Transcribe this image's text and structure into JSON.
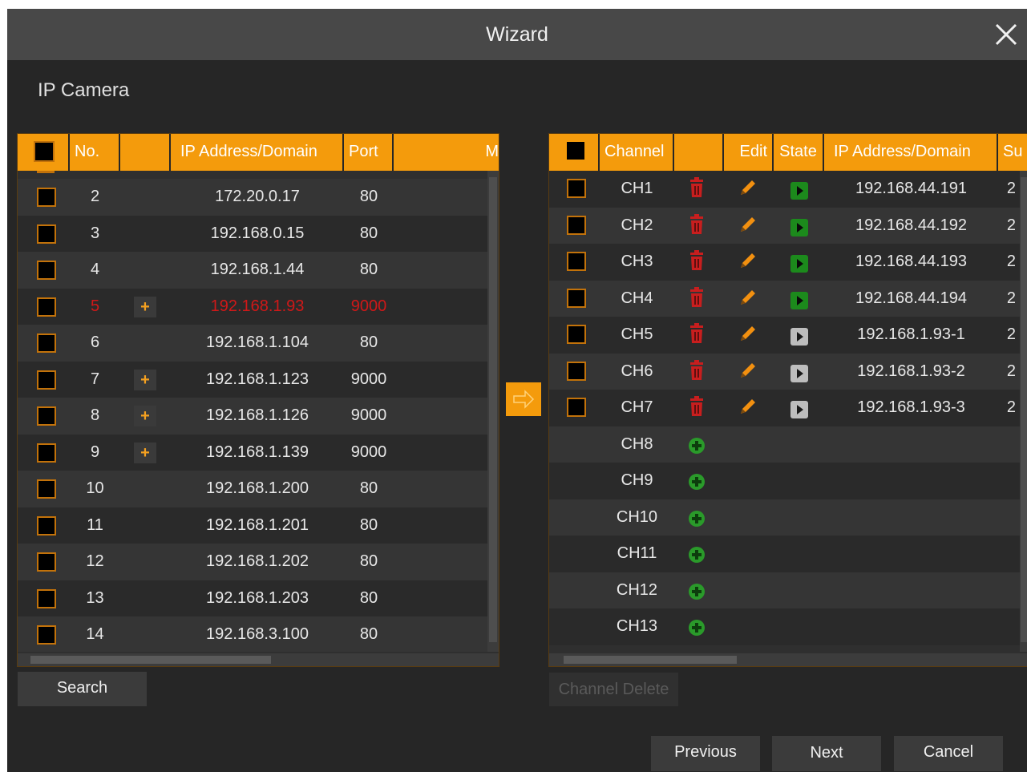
{
  "window": {
    "title": "Wizard",
    "close_icon": "close-icon"
  },
  "section_title": "IP Camera",
  "colors": {
    "accent": "#f49b0c",
    "error_row": "#d01818",
    "add_icon": "#2a9a2a",
    "play_online": "#1c8a1c",
    "play_offline": "#bdbdbd",
    "delete_icon": "#c81e1e",
    "edit_icon": "#f29010"
  },
  "left_table": {
    "headers": {
      "no": "No.",
      "blank": "",
      "ip": "IP Address/Domain",
      "port": "Port",
      "more": "M"
    },
    "rows": [
      {
        "no": "2",
        "add": false,
        "ip": "172.20.0.17",
        "port": "80",
        "error": false
      },
      {
        "no": "3",
        "add": false,
        "ip": "192.168.0.15",
        "port": "80",
        "error": false
      },
      {
        "no": "4",
        "add": false,
        "ip": "192.168.1.44",
        "port": "80",
        "error": false
      },
      {
        "no": "5",
        "add": true,
        "ip": "192.168.1.93",
        "port": "9000",
        "error": true
      },
      {
        "no": "6",
        "add": false,
        "ip": "192.168.1.104",
        "port": "80",
        "error": false
      },
      {
        "no": "7",
        "add": true,
        "ip": "192.168.1.123",
        "port": "9000",
        "error": false
      },
      {
        "no": "8",
        "add": true,
        "ip": "192.168.1.126",
        "port": "9000",
        "error": false
      },
      {
        "no": "9",
        "add": true,
        "ip": "192.168.1.139",
        "port": "9000",
        "error": false
      },
      {
        "no": "10",
        "add": false,
        "ip": "192.168.1.200",
        "port": "80",
        "error": false
      },
      {
        "no": "11",
        "add": false,
        "ip": "192.168.1.201",
        "port": "80",
        "error": false
      },
      {
        "no": "12",
        "add": false,
        "ip": "192.168.1.202",
        "port": "80",
        "error": false
      },
      {
        "no": "13",
        "add": false,
        "ip": "192.168.1.203",
        "port": "80",
        "error": false
      },
      {
        "no": "14",
        "add": false,
        "ip": "192.168.3.100",
        "port": "80",
        "error": false
      }
    ],
    "plus_symbol": "+"
  },
  "right_table": {
    "headers": {
      "channel": "Channel",
      "blank": "",
      "edit": "Edit",
      "state": "State",
      "ip": "IP Address/Domain",
      "sub": "Su"
    },
    "rows": [
      {
        "channel": "CH1",
        "configured": true,
        "online": true,
        "ip": "192.168.44.191",
        "sub": "2"
      },
      {
        "channel": "CH2",
        "configured": true,
        "online": true,
        "ip": "192.168.44.192",
        "sub": "2"
      },
      {
        "channel": "CH3",
        "configured": true,
        "online": true,
        "ip": "192.168.44.193",
        "sub": "2"
      },
      {
        "channel": "CH4",
        "configured": true,
        "online": true,
        "ip": "192.168.44.194",
        "sub": "2"
      },
      {
        "channel": "CH5",
        "configured": true,
        "online": false,
        "ip": "192.168.1.93-1",
        "sub": "2"
      },
      {
        "channel": "CH6",
        "configured": true,
        "online": false,
        "ip": "192.168.1.93-2",
        "sub": "2"
      },
      {
        "channel": "CH7",
        "configured": true,
        "online": false,
        "ip": "192.168.1.93-3",
        "sub": "2"
      },
      {
        "channel": "CH8",
        "configured": false
      },
      {
        "channel": "CH9",
        "configured": false
      },
      {
        "channel": "CH10",
        "configured": false
      },
      {
        "channel": "CH11",
        "configured": false
      },
      {
        "channel": "CH12",
        "configured": false
      },
      {
        "channel": "CH13",
        "configured": false
      }
    ]
  },
  "buttons": {
    "search": "Search",
    "channel_delete": "Channel Delete",
    "previous": "Previous",
    "next": "Next",
    "cancel": "Cancel"
  },
  "icons": {
    "transfer": "arrow-right-icon",
    "delete": "trash-icon",
    "edit": "pencil-icon",
    "state": "play-icon",
    "add": "add-circle-icon"
  }
}
